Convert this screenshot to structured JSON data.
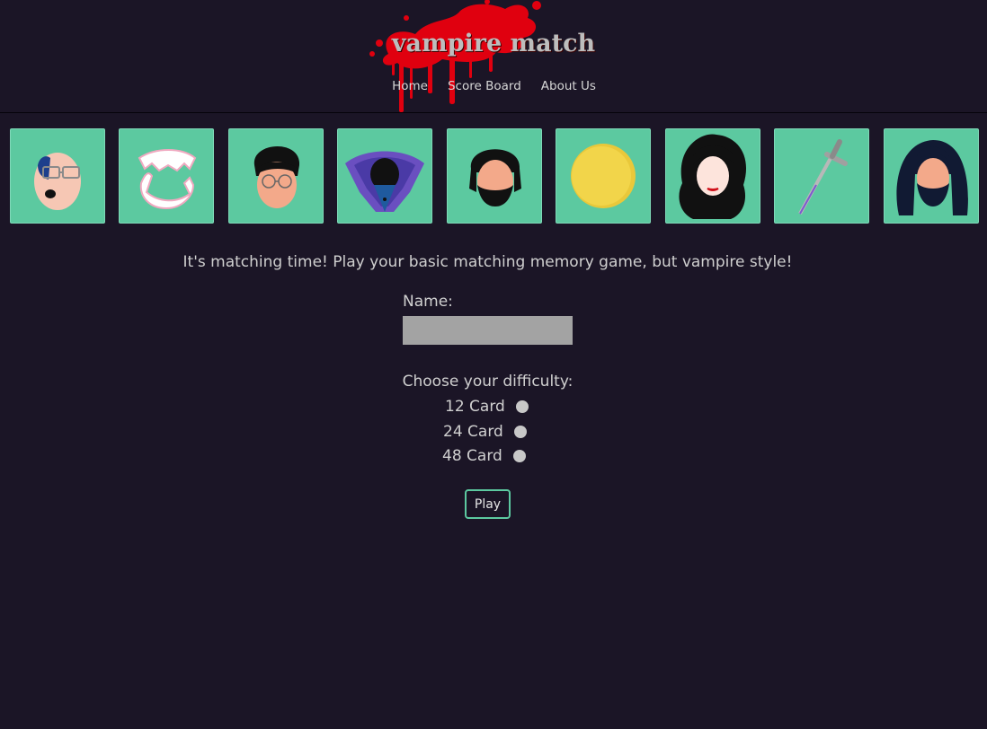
{
  "header": {
    "title": "vampire match",
    "nav": [
      {
        "label": "Home"
      },
      {
        "label": "Score Board"
      },
      {
        "label": "About Us"
      }
    ]
  },
  "cards": [
    {
      "icon": "bald-man-glasses-icon"
    },
    {
      "icon": "vampire-fangs-icon"
    },
    {
      "icon": "man-round-glasses-icon"
    },
    {
      "icon": "vampire-cape-icon"
    },
    {
      "icon": "bearded-man-icon"
    },
    {
      "icon": "gold-coin-icon"
    },
    {
      "icon": "woman-dark-hair-icon"
    },
    {
      "icon": "dagger-icon"
    },
    {
      "icon": "long-hair-bearded-man-icon"
    }
  ],
  "main": {
    "intro": "It's matching time! Play your basic matching memory game, but vampire style!",
    "name_label": "Name:",
    "name_value": "",
    "difficulty_label": "Choose your difficulty:",
    "options": [
      {
        "label": "12 Card"
      },
      {
        "label": "24 Card"
      },
      {
        "label": "48 Card"
      }
    ],
    "play_label": "Play"
  },
  "colors": {
    "background": "#1b1526",
    "card": "#5cc9a0",
    "accent": "#5cc9a0",
    "blood": "#e0000f",
    "text": "#cfcfcf"
  }
}
